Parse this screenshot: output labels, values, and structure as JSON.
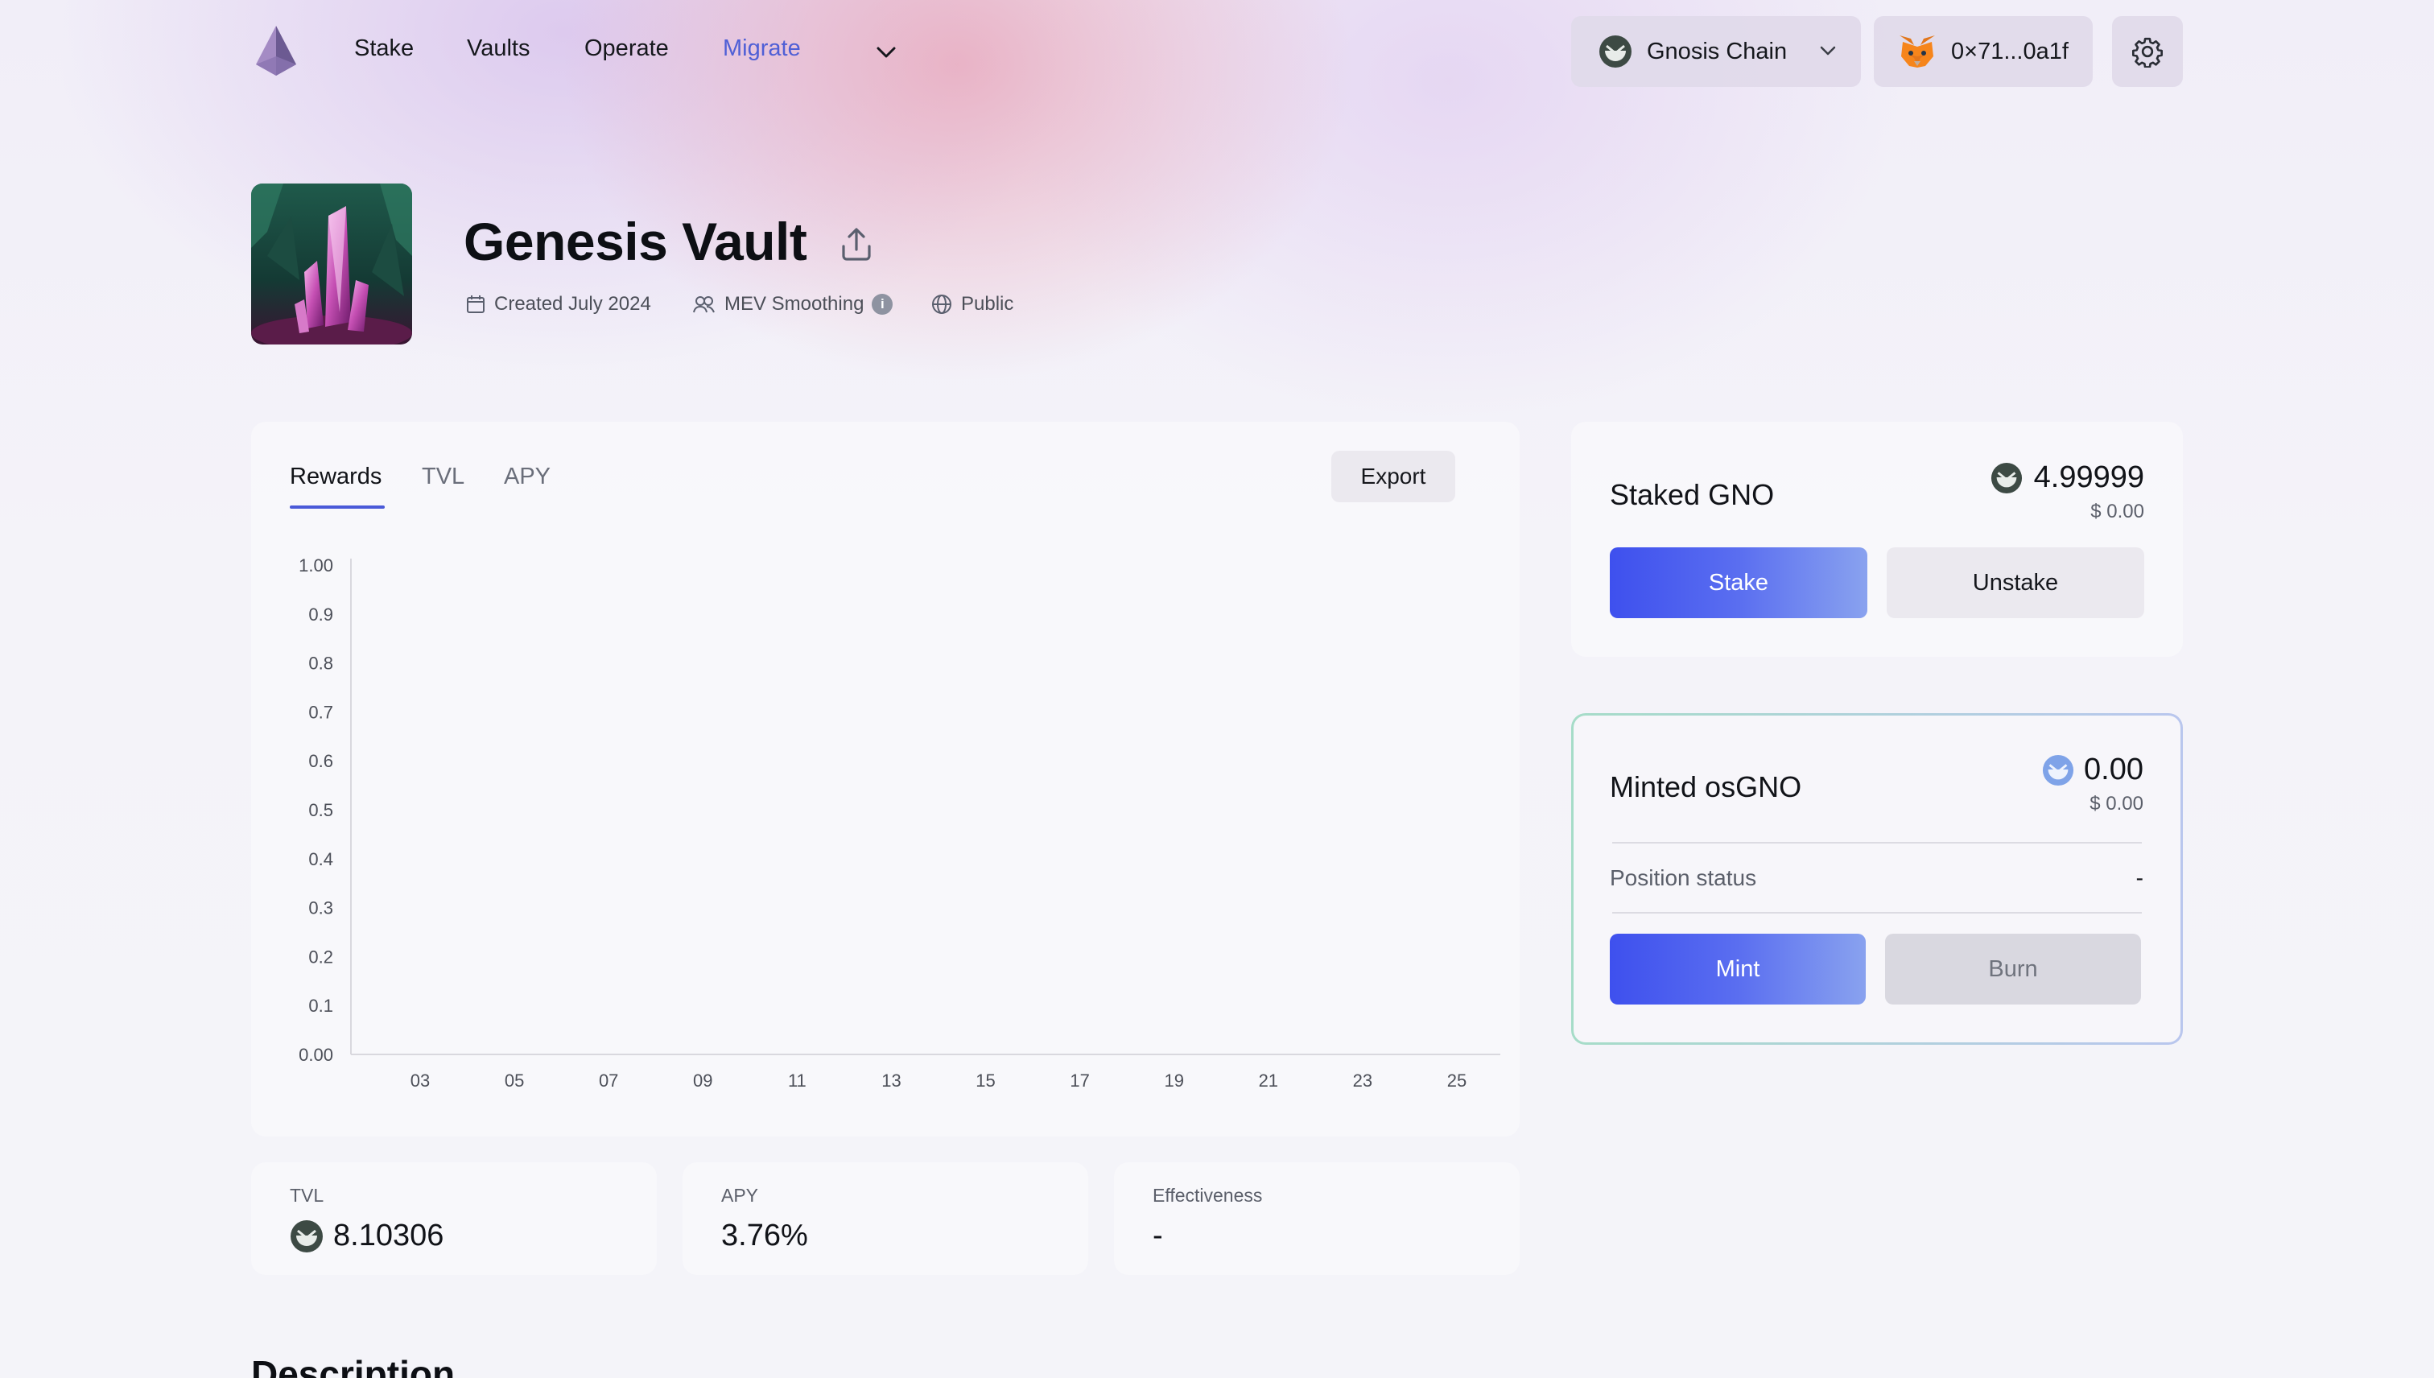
{
  "nav": {
    "links": [
      "Stake",
      "Vaults",
      "Operate",
      "Migrate"
    ],
    "chain_label": "Gnosis Chain",
    "wallet_label": "0×71...0a1f"
  },
  "vault": {
    "title": "Genesis Vault",
    "created": "Created July 2024",
    "feature": "MEV Smoothing",
    "visibility": "Public"
  },
  "chart": {
    "tabs": [
      "Rewards",
      "TVL",
      "APY"
    ],
    "active_tab": "Rewards",
    "export_label": "Export"
  },
  "chart_data": {
    "type": "line",
    "title": "",
    "xlabel": "",
    "ylabel": "",
    "x": [
      "03",
      "05",
      "07",
      "09",
      "11",
      "13",
      "15",
      "17",
      "19",
      "21",
      "23",
      "25"
    ],
    "y_ticks": [
      "1.00",
      "0.9",
      "0.8",
      "0.7",
      "0.6",
      "0.5",
      "0.4",
      "0.3",
      "0.2",
      "0.1",
      "0.00"
    ],
    "ylim": [
      0,
      1
    ],
    "series": []
  },
  "stats": {
    "tvl_label": "TVL",
    "tvl_value": "8.10306",
    "apy_label": "APY",
    "apy_value": "3.76%",
    "eff_label": "Effectiveness",
    "eff_value": "-"
  },
  "staked": {
    "title": "Staked GNO",
    "amount": "4.99999",
    "usd": "$ 0.00",
    "stake_label": "Stake",
    "unstake_label": "Unstake"
  },
  "minted": {
    "title": "Minted osGNO",
    "amount": "0.00",
    "usd": "$ 0.00",
    "position_label": "Position status",
    "position_value": "-",
    "mint_label": "Mint",
    "burn_label": "Burn"
  },
  "description": {
    "heading": "Description"
  },
  "colors": {
    "accent": "#4f5fd6",
    "button_gradient_start": "#3e50ee",
    "button_gradient_end": "#89a2ef",
    "minted_border": "#a6dcc8"
  }
}
